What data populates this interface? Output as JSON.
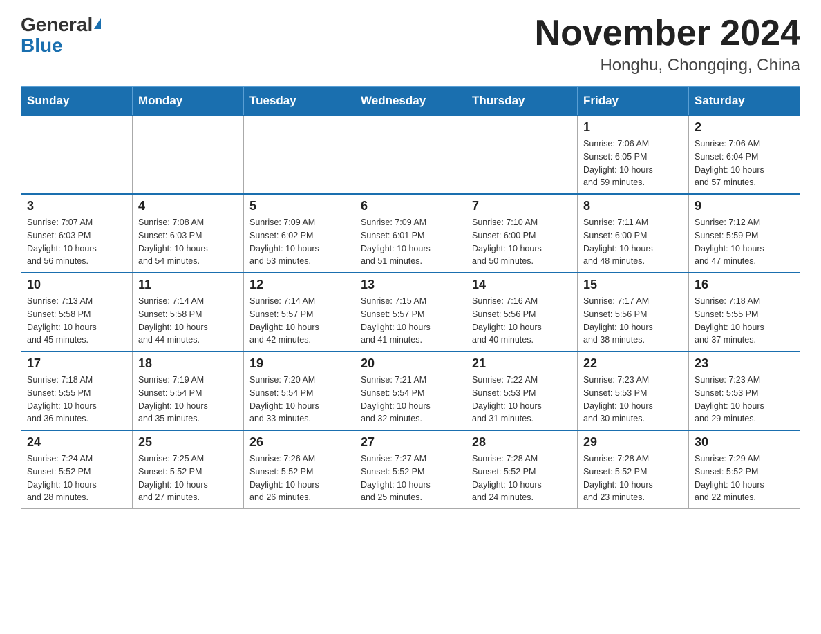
{
  "header": {
    "logo_general": "General",
    "logo_blue": "Blue",
    "month_title": "November 2024",
    "location": "Honghu, Chongqing, China"
  },
  "days_of_week": [
    "Sunday",
    "Monday",
    "Tuesday",
    "Wednesday",
    "Thursday",
    "Friday",
    "Saturday"
  ],
  "weeks": [
    [
      {
        "day": "",
        "info": ""
      },
      {
        "day": "",
        "info": ""
      },
      {
        "day": "",
        "info": ""
      },
      {
        "day": "",
        "info": ""
      },
      {
        "day": "",
        "info": ""
      },
      {
        "day": "1",
        "info": "Sunrise: 7:06 AM\nSunset: 6:05 PM\nDaylight: 10 hours\nand 59 minutes."
      },
      {
        "day": "2",
        "info": "Sunrise: 7:06 AM\nSunset: 6:04 PM\nDaylight: 10 hours\nand 57 minutes."
      }
    ],
    [
      {
        "day": "3",
        "info": "Sunrise: 7:07 AM\nSunset: 6:03 PM\nDaylight: 10 hours\nand 56 minutes."
      },
      {
        "day": "4",
        "info": "Sunrise: 7:08 AM\nSunset: 6:03 PM\nDaylight: 10 hours\nand 54 minutes."
      },
      {
        "day": "5",
        "info": "Sunrise: 7:09 AM\nSunset: 6:02 PM\nDaylight: 10 hours\nand 53 minutes."
      },
      {
        "day": "6",
        "info": "Sunrise: 7:09 AM\nSunset: 6:01 PM\nDaylight: 10 hours\nand 51 minutes."
      },
      {
        "day": "7",
        "info": "Sunrise: 7:10 AM\nSunset: 6:00 PM\nDaylight: 10 hours\nand 50 minutes."
      },
      {
        "day": "8",
        "info": "Sunrise: 7:11 AM\nSunset: 6:00 PM\nDaylight: 10 hours\nand 48 minutes."
      },
      {
        "day": "9",
        "info": "Sunrise: 7:12 AM\nSunset: 5:59 PM\nDaylight: 10 hours\nand 47 minutes."
      }
    ],
    [
      {
        "day": "10",
        "info": "Sunrise: 7:13 AM\nSunset: 5:58 PM\nDaylight: 10 hours\nand 45 minutes."
      },
      {
        "day": "11",
        "info": "Sunrise: 7:14 AM\nSunset: 5:58 PM\nDaylight: 10 hours\nand 44 minutes."
      },
      {
        "day": "12",
        "info": "Sunrise: 7:14 AM\nSunset: 5:57 PM\nDaylight: 10 hours\nand 42 minutes."
      },
      {
        "day": "13",
        "info": "Sunrise: 7:15 AM\nSunset: 5:57 PM\nDaylight: 10 hours\nand 41 minutes."
      },
      {
        "day": "14",
        "info": "Sunrise: 7:16 AM\nSunset: 5:56 PM\nDaylight: 10 hours\nand 40 minutes."
      },
      {
        "day": "15",
        "info": "Sunrise: 7:17 AM\nSunset: 5:56 PM\nDaylight: 10 hours\nand 38 minutes."
      },
      {
        "day": "16",
        "info": "Sunrise: 7:18 AM\nSunset: 5:55 PM\nDaylight: 10 hours\nand 37 minutes."
      }
    ],
    [
      {
        "day": "17",
        "info": "Sunrise: 7:18 AM\nSunset: 5:55 PM\nDaylight: 10 hours\nand 36 minutes."
      },
      {
        "day": "18",
        "info": "Sunrise: 7:19 AM\nSunset: 5:54 PM\nDaylight: 10 hours\nand 35 minutes."
      },
      {
        "day": "19",
        "info": "Sunrise: 7:20 AM\nSunset: 5:54 PM\nDaylight: 10 hours\nand 33 minutes."
      },
      {
        "day": "20",
        "info": "Sunrise: 7:21 AM\nSunset: 5:54 PM\nDaylight: 10 hours\nand 32 minutes."
      },
      {
        "day": "21",
        "info": "Sunrise: 7:22 AM\nSunset: 5:53 PM\nDaylight: 10 hours\nand 31 minutes."
      },
      {
        "day": "22",
        "info": "Sunrise: 7:23 AM\nSunset: 5:53 PM\nDaylight: 10 hours\nand 30 minutes."
      },
      {
        "day": "23",
        "info": "Sunrise: 7:23 AM\nSunset: 5:53 PM\nDaylight: 10 hours\nand 29 minutes."
      }
    ],
    [
      {
        "day": "24",
        "info": "Sunrise: 7:24 AM\nSunset: 5:52 PM\nDaylight: 10 hours\nand 28 minutes."
      },
      {
        "day": "25",
        "info": "Sunrise: 7:25 AM\nSunset: 5:52 PM\nDaylight: 10 hours\nand 27 minutes."
      },
      {
        "day": "26",
        "info": "Sunrise: 7:26 AM\nSunset: 5:52 PM\nDaylight: 10 hours\nand 26 minutes."
      },
      {
        "day": "27",
        "info": "Sunrise: 7:27 AM\nSunset: 5:52 PM\nDaylight: 10 hours\nand 25 minutes."
      },
      {
        "day": "28",
        "info": "Sunrise: 7:28 AM\nSunset: 5:52 PM\nDaylight: 10 hours\nand 24 minutes."
      },
      {
        "day": "29",
        "info": "Sunrise: 7:28 AM\nSunset: 5:52 PM\nDaylight: 10 hours\nand 23 minutes."
      },
      {
        "day": "30",
        "info": "Sunrise: 7:29 AM\nSunset: 5:52 PM\nDaylight: 10 hours\nand 22 minutes."
      }
    ]
  ]
}
